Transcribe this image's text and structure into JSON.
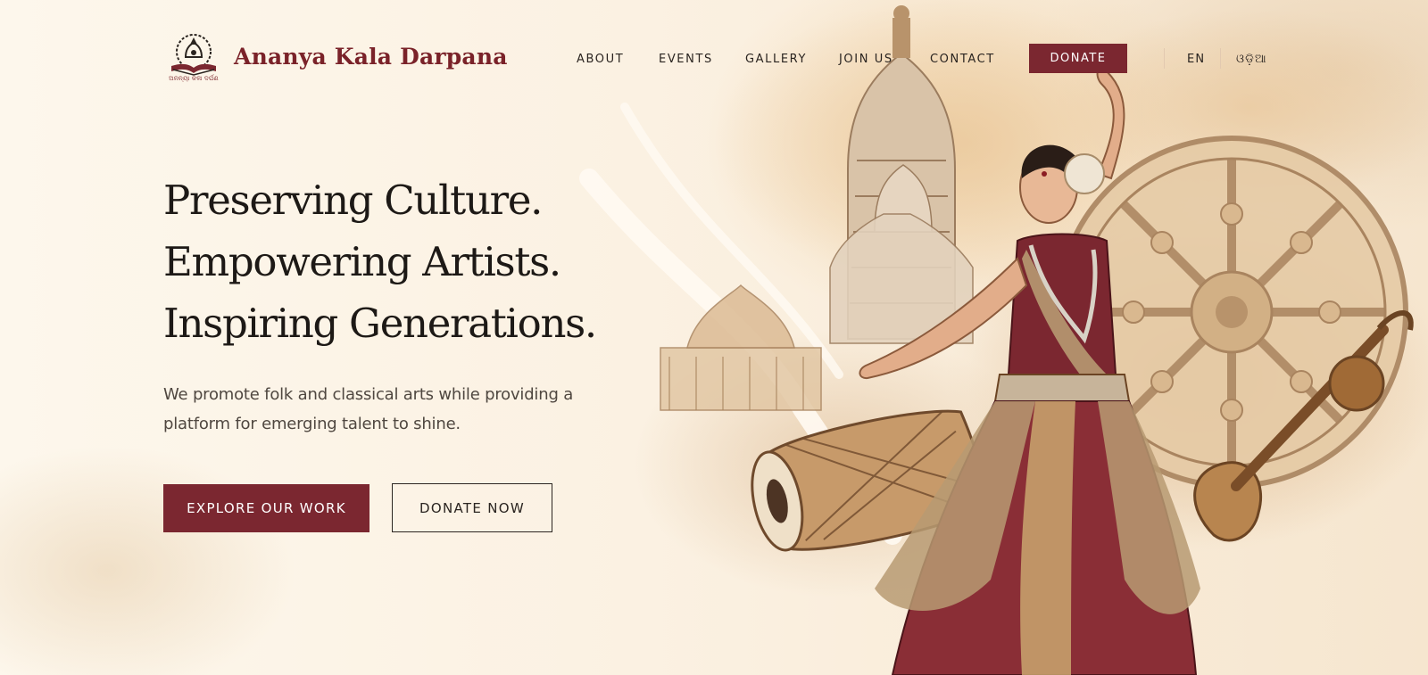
{
  "brand": {
    "name": "Ananya Kala Darpana",
    "logo_caption": "ଅନନ୍ୟା କଳା ଦର୍ପଣ",
    "logo_icon": "temple-book-emblem-icon"
  },
  "nav": {
    "items": [
      {
        "label": "ABOUT"
      },
      {
        "label": "EVENTS"
      },
      {
        "label": "GALLERY"
      },
      {
        "label": "JOIN US"
      },
      {
        "label": "CONTACT"
      }
    ],
    "donate_label": "DONATE",
    "languages": [
      "EN",
      "ଓଡ଼ିଆ"
    ]
  },
  "hero": {
    "title_lines": [
      "Preserving Culture.",
      "Empowering Artists.",
      "Inspiring Generations."
    ],
    "description": "We promote folk and classical arts while providing a platform for emerging talent to shine.",
    "primary_button": "EXPLORE OUR WORK",
    "secondary_button": "DONATE NOW"
  },
  "illustration": {
    "subject": "odissi-dancer-with-temple-wheel-drum-veena",
    "icons": [
      "temple-icon",
      "konark-wheel-icon",
      "mardala-drum-icon",
      "veena-icon",
      "dancer-icon"
    ]
  },
  "colors": {
    "accent": "#7b2730",
    "background": "#fbf3e6",
    "text": "#1d1916"
  }
}
